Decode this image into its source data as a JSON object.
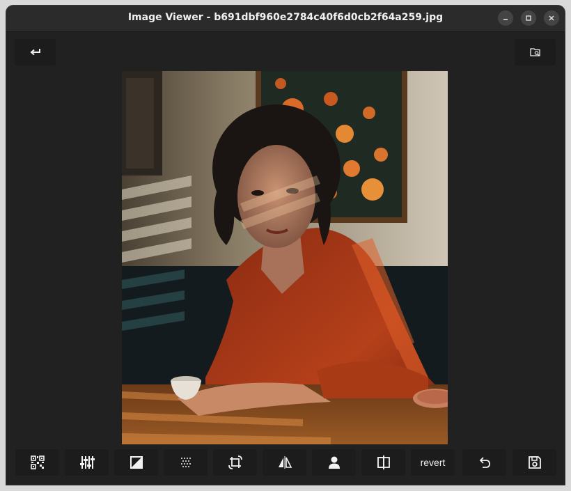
{
  "window": {
    "title": "Image Viewer - b691dbf960e2784c40f6d0cb2f64a259.jpg"
  },
  "header": {
    "back_icon": "return-arrow-icon",
    "folder_icon": "folder-search-icon"
  },
  "toolbar": {
    "buttons": [
      {
        "icon": "qr-code-icon"
      },
      {
        "icon": "adjust-sliders-icon"
      },
      {
        "icon": "image-filter-icon"
      },
      {
        "icon": "grain-dots-icon"
      },
      {
        "icon": "crop-rotate-icon"
      },
      {
        "icon": "flip-horizontal-icon"
      },
      {
        "icon": "person-icon"
      },
      {
        "icon": "split-compare-icon"
      },
      {
        "label": "revert"
      },
      {
        "icon": "undo-icon"
      },
      {
        "icon": "save-disk-icon"
      }
    ]
  },
  "colors": {
    "background": "#212121",
    "titlebar": "#2b2b2b",
    "button": "#1c1c1c",
    "text": "#f0f0f0"
  }
}
